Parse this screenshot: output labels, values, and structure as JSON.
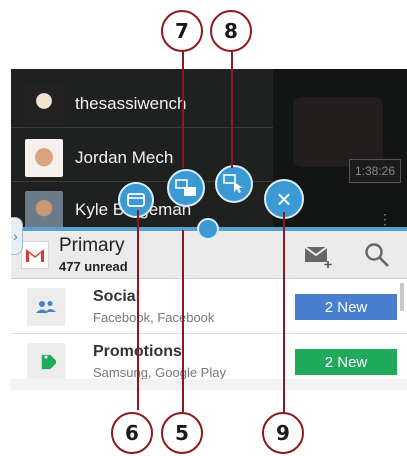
{
  "callouts": {
    "c7": "7",
    "c8": "8",
    "c6": "6",
    "c5": "5",
    "c9": "9"
  },
  "video_panel": {
    "users": [
      {
        "name": "thesassiwench"
      },
      {
        "name": "Jordan Mech"
      },
      {
        "name": "Kyle Bergeman"
      }
    ],
    "duration": "1:38:26",
    "menu_glyph": "⋮"
  },
  "controls": {
    "expand_glyph": "›",
    "close_glyph": "×"
  },
  "gmail": {
    "header": {
      "title": "Primary",
      "unread": "477 unread"
    },
    "categories": [
      {
        "title": "Social",
        "subtitle": "Facebook, Facebook",
        "badge": "2 New",
        "badge_color": "#4a7fcf",
        "icon": "people-icon"
      },
      {
        "title": "Promotions",
        "subtitle": "Samsung, Google Play",
        "badge": "2 New",
        "badge_color": "#1faa5c",
        "icon": "tag-icon"
      }
    ]
  },
  "colors": {
    "accent_blue": "#3b9ad4",
    "callout_red": "#8b1a1a"
  }
}
